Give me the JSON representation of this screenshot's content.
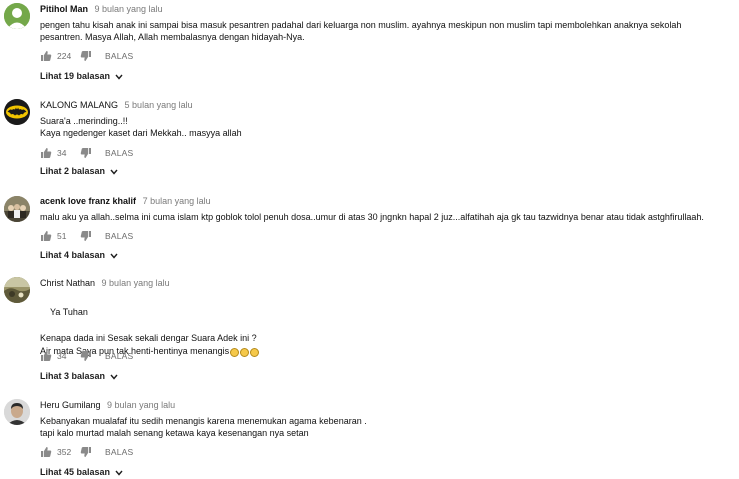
{
  "comments": [
    {
      "author": "Pitihol Man",
      "time": "9 bulan yang lalu",
      "text": "pengen tahu kisah anak ini sampai bisa masuk pesantren padahal dari keluarga non muslim. ayahnya meskipun non muslim tapi membolehkan anaknya sekolah\npesantren. Masya Allah, Allah membalasnya dengan hidayah-Nya.",
      "likes": "224",
      "reply_label": "BALAS",
      "replies_label": "Lihat 19 balasan",
      "avatar_color": "#74a84a"
    },
    {
      "author": "KALONG MALANG",
      "time": "5 bulan yang lalu",
      "text": "Suara'a ..merinding..!!\nKaya ngedenger kaset dari Mekkah.. masyya allah",
      "likes": "34",
      "reply_label": "BALAS",
      "replies_label": "Lihat 2 balasan",
      "avatar_color": "#1a1a1a"
    },
    {
      "author": "acenk love franz khalif",
      "time": "7 bulan yang lalu",
      "text": "malu aku ya allah..selma ini cuma islam ktp goblok tolol penuh dosa..umur di atas 30 jngnkn hapal 2 juz...alfatihah aja gk tau tazwidnya benar atau tidak astghfirullaah.",
      "likes": "51",
      "reply_label": "BALAS",
      "replies_label": "Lihat 4 balasan",
      "avatar_color": "#6f6a58"
    },
    {
      "author": "Christ Nathan",
      "time": "9 bulan yang lalu",
      "text": "Ya Tuhan\n\nKenapa dada ini Sesak sekali dengar Suara Adek ini ?\nAir mata Saya pun tak henti-hentinya menangis",
      "emojis": [
        "😭",
        "😭",
        "😭"
      ],
      "likes": "34",
      "reply_label": "BALAS",
      "replies_label": "Lihat 3 balasan",
      "avatar_color": "#7d7a52"
    },
    {
      "author": "Heru Gumilang",
      "time": "9 bulan yang lalu",
      "text": "Kebanyakan mualafaf itu sedih menangis karena menemukan agama kebenaran .\ntapi kalo murtad malah senang ketawa kaya kesenangan nya setan",
      "likes": "352",
      "reply_label": "BALAS",
      "replies_label": "Lihat 45 balasan",
      "avatar_color": "#cfcfcf"
    }
  ],
  "icons": {
    "like": "thumbs-up-icon",
    "dislike": "thumbs-down-icon",
    "expand": "chevron-down-icon"
  }
}
